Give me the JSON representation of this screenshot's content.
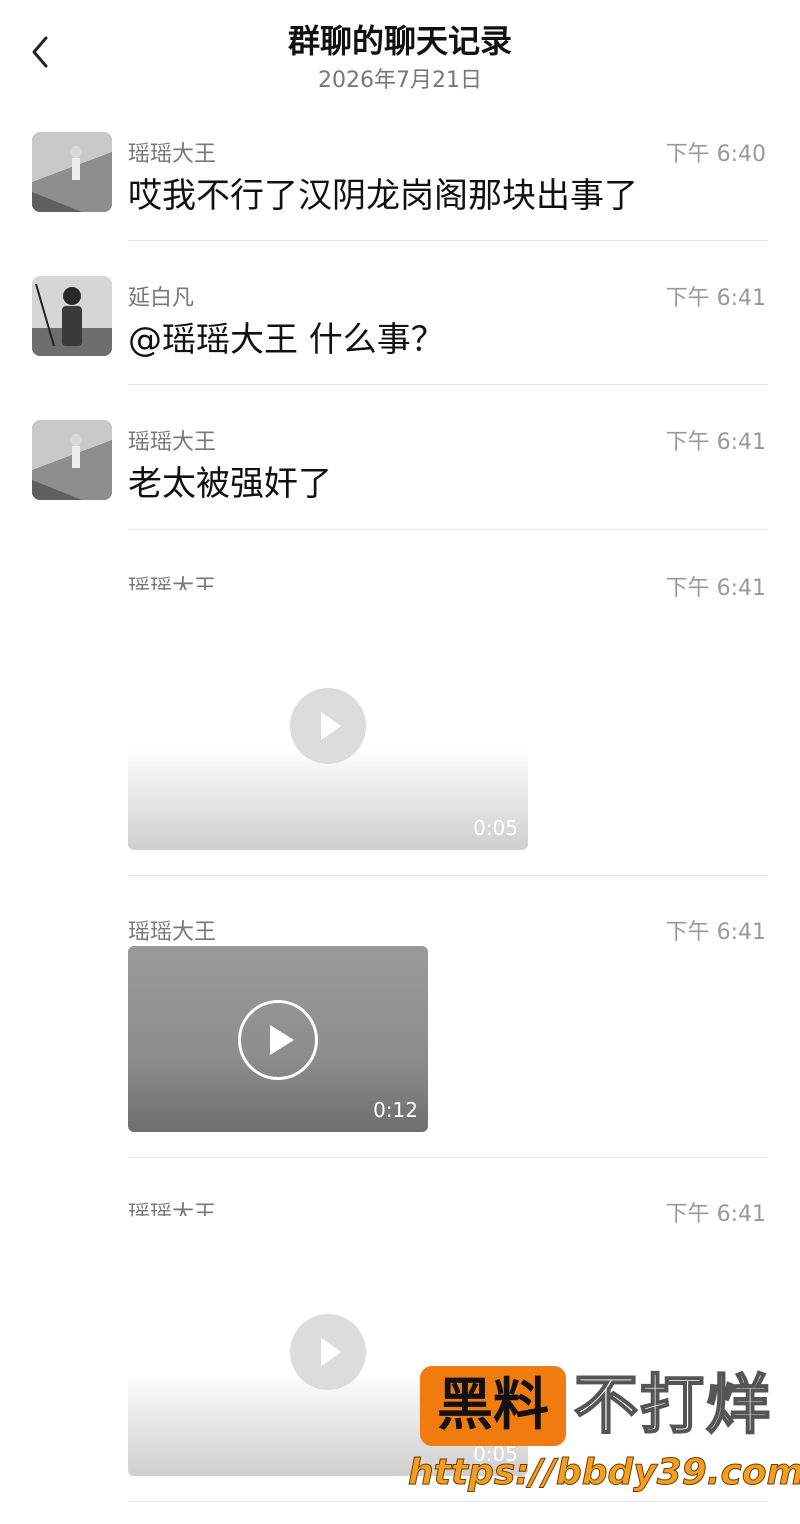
{
  "header": {
    "title": "群聊的聊天记录",
    "date": "2026年7月21日",
    "back_icon": "chevron-left-icon"
  },
  "messages": [
    {
      "sender": "瑶瑶大王",
      "time": "下午 6:40",
      "text": "哎我不行了汉阴龙岗阁那块出事了"
    },
    {
      "sender": "延白凡",
      "time": "下午 6:41",
      "text": "@瑶瑶大王 什么事？"
    },
    {
      "sender": "瑶瑶大王",
      "time": "下午 6:41",
      "text": "老太被强奸了"
    },
    {
      "sender": "瑶瑶大王",
      "time": "下午 6:41",
      "video_duration": "0:05"
    },
    {
      "sender": "瑶瑶大王",
      "time": "下午 6:41",
      "video_duration": "0:12"
    },
    {
      "sender": "瑶瑶大王",
      "time": "下午 6:41",
      "video_duration": "0:05"
    }
  ],
  "watermark": {
    "badge": "黑料",
    "text": "不打烊",
    "url": "https://bbdy39.com"
  },
  "colors": {
    "watermark_orange": "#f07c10",
    "divider": "#e3e3e3",
    "secondary_text": "#777777"
  }
}
